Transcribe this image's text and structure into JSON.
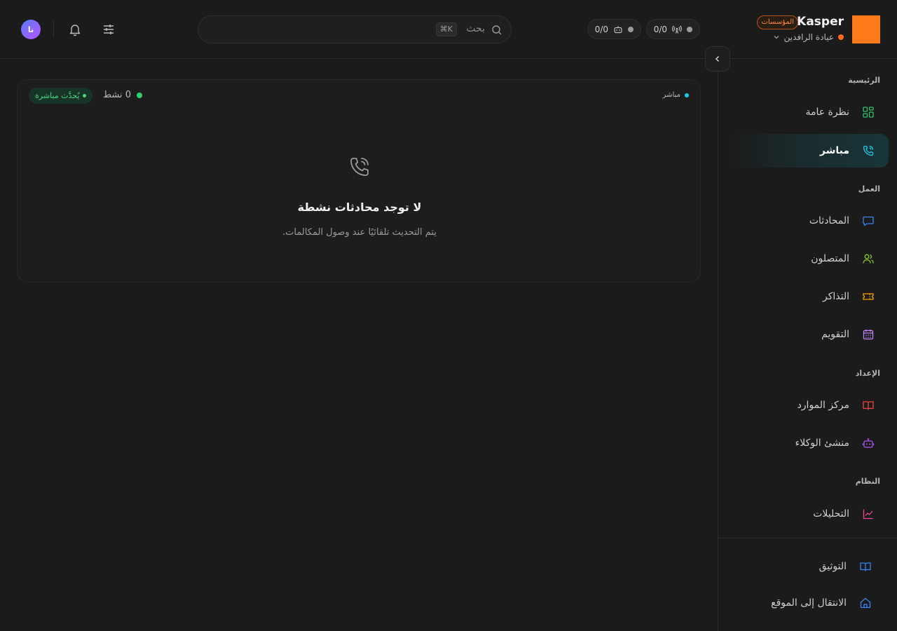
{
  "header": {
    "brand_name": "Kasper",
    "plan_badge": "المؤسسات",
    "org_name": "عيادة الرافدين",
    "stat_pills": [
      {
        "icon": "broadcast-icon",
        "value": "0/0"
      },
      {
        "icon": "bot-icon",
        "value": "0/0"
      }
    ],
    "search": {
      "label": "بحث",
      "shortcut": "⌘K"
    },
    "avatar_initials": "نا"
  },
  "sidebar": {
    "sections": [
      {
        "title": "الرئيسية",
        "items": [
          {
            "label": "نظرة عامة",
            "icon": "grid-icon",
            "color": "#2fbf71"
          },
          {
            "label": "مباشر",
            "icon": "phone-call-icon",
            "color": "#1ec8e8",
            "active": true
          }
        ]
      },
      {
        "title": "العمل",
        "items": [
          {
            "label": "المحادثات",
            "icon": "chat-icon",
            "color": "#3b82f6"
          },
          {
            "label": "المتصلون",
            "icon": "users-icon",
            "color": "#84cc16"
          },
          {
            "label": "التذاكر",
            "icon": "ticket-icon",
            "color": "#f59e0b"
          },
          {
            "label": "التقويم",
            "icon": "calendar-icon",
            "color": "#c084fc"
          }
        ]
      },
      {
        "title": "الإعداد",
        "items": [
          {
            "label": "مركز الموارد",
            "icon": "book-icon",
            "color": "#ef4444"
          },
          {
            "label": "منشئ الوكلاء",
            "icon": "bot-icon",
            "color": "#a855f7"
          }
        ]
      },
      {
        "title": "النظام",
        "items": [
          {
            "label": "التحليلات",
            "icon": "chart-icon",
            "color": "#ec4899"
          }
        ]
      }
    ],
    "footer": [
      {
        "label": "التوثيق",
        "icon": "book-open-icon",
        "color": "#3b82f6"
      },
      {
        "label": "الانتقال إلى الموقع",
        "icon": "home-icon",
        "color": "#3b82f6"
      }
    ]
  },
  "main": {
    "live_tag": "مباشر",
    "active_count": "0 نشط",
    "live_update": "يُحدَّث مباشرة",
    "empty_title": "لا توجد محادثات نشطة",
    "empty_desc": "يتم التحديث تلقائيًا عند وصول المكالمات."
  }
}
